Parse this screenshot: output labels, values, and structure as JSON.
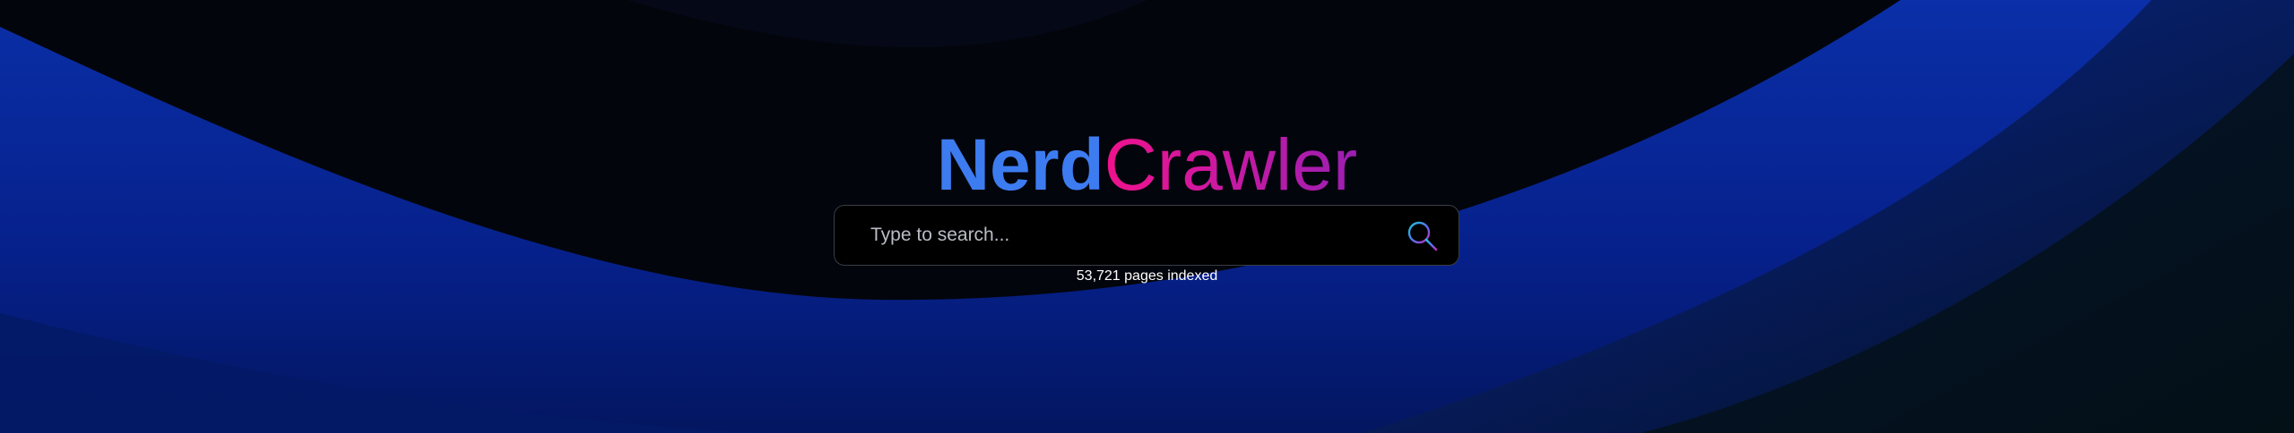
{
  "logo": {
    "part1": "Nerd",
    "part2": "Crawler"
  },
  "search": {
    "placeholder": "Type to search...",
    "value": "",
    "icon": "magnifier-gradient-icon"
  },
  "stats": {
    "indexed_text": "53,721 pages indexed"
  },
  "colors": {
    "logo_nerd": "#3d7cf0",
    "logo_crawler_start": "#f0128c",
    "logo_crawler_end": "#9a1fb2",
    "background_dark": "#03050c",
    "background_wave": "#0a2a9a"
  }
}
